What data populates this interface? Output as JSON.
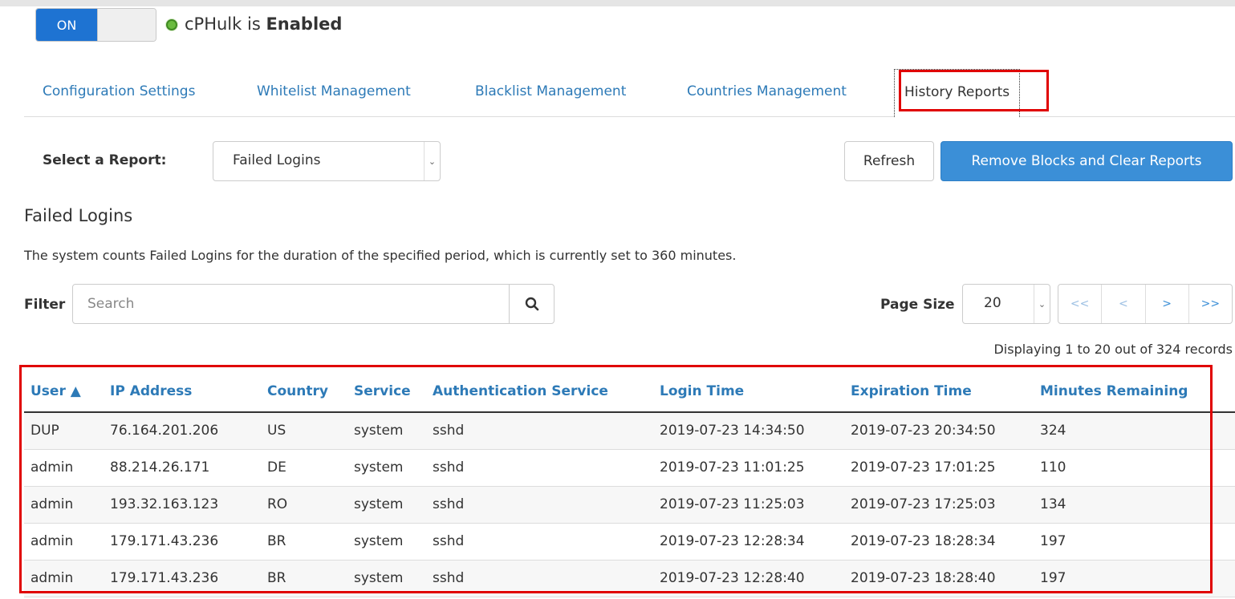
{
  "toggle": {
    "label": "ON"
  },
  "status": {
    "prefix": "cPHulk is",
    "state": "Enabled",
    "dot_color": "#6abb3f"
  },
  "tabs": [
    {
      "label": "Configuration Settings"
    },
    {
      "label": "Whitelist Management"
    },
    {
      "label": "Blacklist Management"
    },
    {
      "label": "Countries Management"
    },
    {
      "label": "History Reports",
      "active": true
    }
  ],
  "report": {
    "select_label": "Select a Report:",
    "selected": "Failed Logins",
    "refresh_label": "Refresh",
    "clear_label": "Remove Blocks and Clear Reports"
  },
  "section": {
    "title": "Failed Logins",
    "description": "The system counts Failed Logins for the duration of the specified period, which is currently set to 360 minutes."
  },
  "filter": {
    "label": "Filter",
    "placeholder": "Search",
    "search_icon": "search-icon"
  },
  "paging": {
    "page_size_label": "Page Size",
    "page_size": "20",
    "first": "<<",
    "prev": "<",
    "next": ">",
    "last": ">>",
    "displaying": "Displaying 1 to 20 out of 324 records"
  },
  "table": {
    "columns": [
      "User ▲",
      "IP Address",
      "Country",
      "Service",
      "Authentication Service",
      "Login Time",
      "Expiration Time",
      "Minutes Remaining"
    ],
    "rows": [
      [
        "DUP",
        "76.164.201.206",
        "US",
        "system",
        "sshd",
        "2019-07-23 14:34:50",
        "2019-07-23 20:34:50",
        "324"
      ],
      [
        "admin",
        "88.214.26.171",
        "DE",
        "system",
        "sshd",
        "2019-07-23 11:01:25",
        "2019-07-23 17:01:25",
        "110"
      ],
      [
        "admin",
        "193.32.163.123",
        "RO",
        "system",
        "sshd",
        "2019-07-23 11:25:03",
        "2019-07-23 17:25:03",
        "134"
      ],
      [
        "admin",
        "179.171.43.236",
        "BR",
        "system",
        "sshd",
        "2019-07-23 12:28:34",
        "2019-07-23 18:28:34",
        "197"
      ],
      [
        "admin",
        "179.171.43.236",
        "BR",
        "system",
        "sshd",
        "2019-07-23 12:28:40",
        "2019-07-23 18:28:40",
        "197"
      ]
    ]
  },
  "colors": {
    "link": "#2d7ab7",
    "primary": "#3b8fd7",
    "highlight": "#e00000",
    "toggle_on": "#1e73d2"
  }
}
